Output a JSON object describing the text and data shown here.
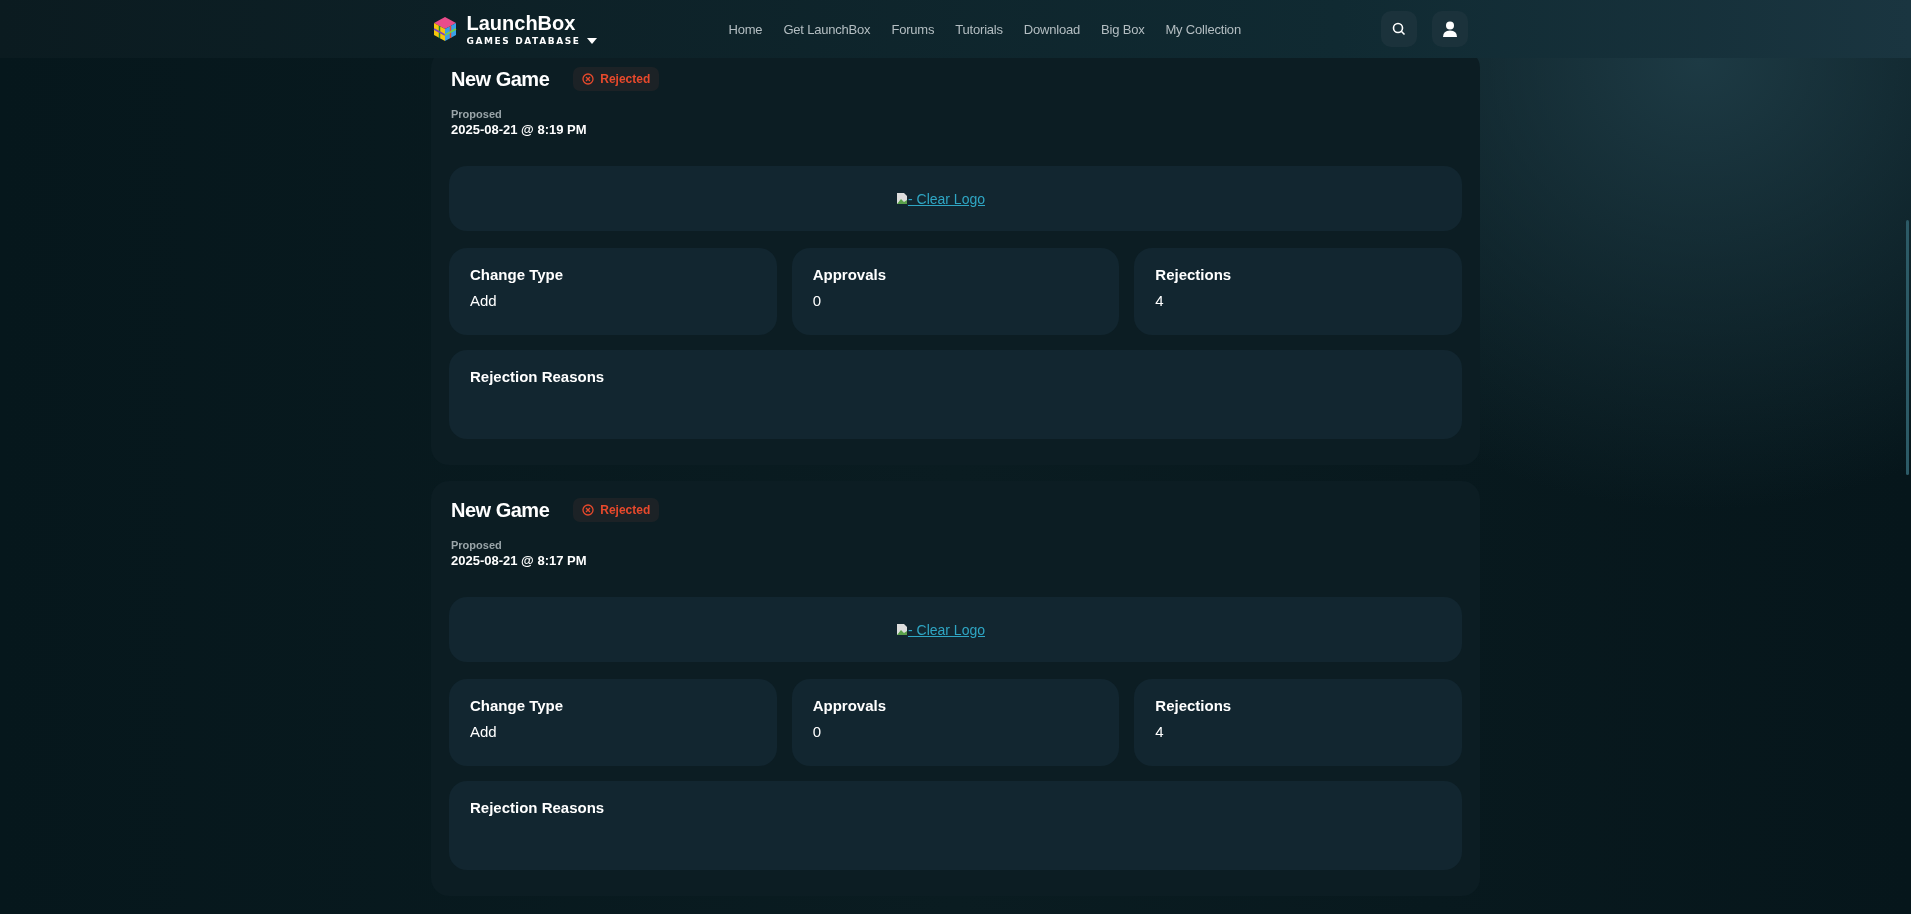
{
  "header": {
    "brand": "LaunchBox",
    "subtitle": "GAMES DATABASE",
    "nav": [
      "Home",
      "Get LaunchBox",
      "Forums",
      "Tutorials",
      "Download",
      "Big Box",
      "My Collection"
    ]
  },
  "submissions": [
    {
      "title": "New Game",
      "status": {
        "kind": "rejected",
        "label": "Rejected"
      },
      "proposed_label": "Proposed",
      "proposed": "2025-08-21 @ 8:19 PM",
      "logo_link": "- Clear Logo",
      "stats": [
        {
          "label": "Change Type",
          "value": "Add"
        },
        {
          "label": "Approvals",
          "value": "0"
        },
        {
          "label": "Rejections",
          "value": "4"
        }
      ],
      "reasons_label": "Rejection Reasons"
    },
    {
      "title": "New Game",
      "status": {
        "kind": "rejected",
        "label": "Rejected"
      },
      "proposed_label": "Proposed",
      "proposed": "2025-08-21 @ 8:17 PM",
      "logo_link": "- Clear Logo",
      "stats": [
        {
          "label": "Change Type",
          "value": "Add"
        },
        {
          "label": "Approvals",
          "value": "0"
        },
        {
          "label": "Rejections",
          "value": "4"
        }
      ],
      "reasons_label": "Rejection Reasons"
    }
  ]
}
